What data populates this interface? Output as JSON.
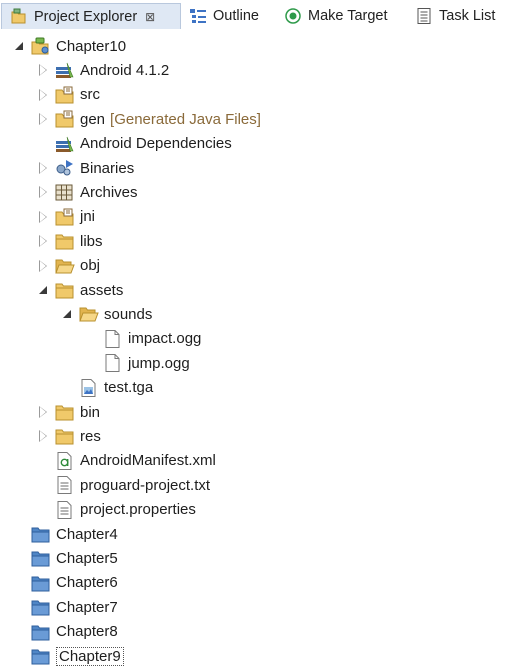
{
  "tabs": [
    {
      "label": "Project Explorer",
      "icon": "project-explorer-icon",
      "active": true,
      "close": "⊠"
    },
    {
      "label": "Outline",
      "icon": "outline-icon",
      "active": false
    },
    {
      "label": "Make Target",
      "icon": "make-target-icon",
      "active": false
    },
    {
      "label": "Task List",
      "icon": "task-list-icon",
      "active": false
    }
  ],
  "tree": [
    {
      "label": "Chapter10",
      "icon": "android-project-icon",
      "twisty": "expanded",
      "depth": 0
    },
    {
      "label": "Android 4.1.2",
      "icon": "library-icon",
      "twisty": "collapsed",
      "depth": 1
    },
    {
      "label": "src",
      "icon": "source-folder-icon",
      "twisty": "collapsed",
      "depth": 1
    },
    {
      "label": "gen",
      "icon": "source-folder-icon",
      "twisty": "collapsed",
      "depth": 1,
      "decoration": "[Generated Java Files]"
    },
    {
      "label": "Android Dependencies",
      "icon": "library-icon",
      "twisty": "none",
      "depth": 1
    },
    {
      "label": "Binaries",
      "icon": "binaries-icon",
      "twisty": "collapsed",
      "depth": 1
    },
    {
      "label": "Archives",
      "icon": "archives-icon",
      "twisty": "collapsed",
      "depth": 1
    },
    {
      "label": "jni",
      "icon": "source-folder-icon",
      "twisty": "collapsed",
      "depth": 1
    },
    {
      "label": "libs",
      "icon": "folder-icon",
      "twisty": "collapsed",
      "depth": 1
    },
    {
      "label": "obj",
      "icon": "folder-open-icon",
      "twisty": "collapsed",
      "depth": 1
    },
    {
      "label": "assets",
      "icon": "folder-icon",
      "twisty": "expanded",
      "depth": 1
    },
    {
      "label": "sounds",
      "icon": "folder-open-icon",
      "twisty": "expanded",
      "depth": 2
    },
    {
      "label": "impact.ogg",
      "icon": "file-icon",
      "twisty": "none",
      "depth": 3
    },
    {
      "label": "jump.ogg",
      "icon": "file-icon",
      "twisty": "none",
      "depth": 3
    },
    {
      "label": "test.tga",
      "icon": "image-file-icon",
      "twisty": "none",
      "depth": 2
    },
    {
      "label": "bin",
      "icon": "folder-icon",
      "twisty": "collapsed",
      "depth": 1
    },
    {
      "label": "res",
      "icon": "folder-icon",
      "twisty": "collapsed",
      "depth": 1
    },
    {
      "label": "AndroidManifest.xml",
      "icon": "xml-file-icon",
      "twisty": "none",
      "depth": 1
    },
    {
      "label": "proguard-project.txt",
      "icon": "text-file-icon",
      "twisty": "none",
      "depth": 1
    },
    {
      "label": "project.properties",
      "icon": "text-file-icon",
      "twisty": "none",
      "depth": 1
    },
    {
      "label": "Chapter4",
      "icon": "closed-project-icon",
      "twisty": "none",
      "depth": 0
    },
    {
      "label": "Chapter5",
      "icon": "closed-project-icon",
      "twisty": "none",
      "depth": 0
    },
    {
      "label": "Chapter6",
      "icon": "closed-project-icon",
      "twisty": "none",
      "depth": 0
    },
    {
      "label": "Chapter7",
      "icon": "closed-project-icon",
      "twisty": "none",
      "depth": 0
    },
    {
      "label": "Chapter8",
      "icon": "closed-project-icon",
      "twisty": "none",
      "depth": 0
    },
    {
      "label": "Chapter9",
      "icon": "closed-project-icon",
      "twisty": "none",
      "depth": 0,
      "focused": true
    }
  ],
  "colors": {
    "folder": "#e9c46a",
    "folder_stroke": "#b8902e",
    "project_closed": "#4f86c6",
    "decoration": "#8a6a3a",
    "tab_active_bg": "#dfe8f4"
  }
}
